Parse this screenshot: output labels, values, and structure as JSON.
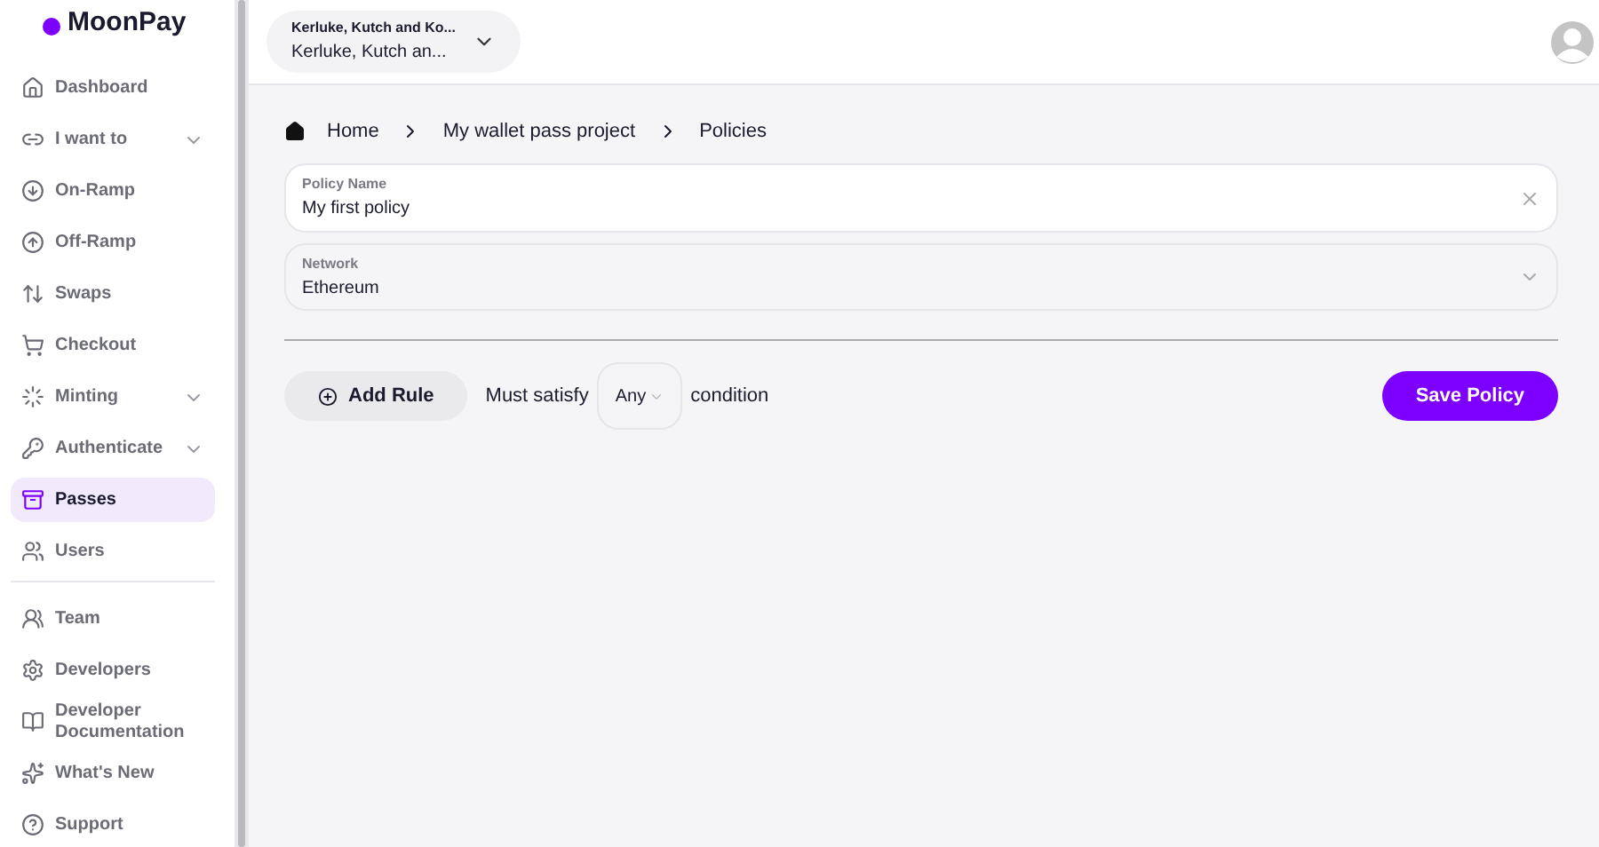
{
  "brand": {
    "name": "MoonPay"
  },
  "sidebar": {
    "groups": [
      {
        "items": [
          {
            "label": "Dashboard",
            "has_submenu": false,
            "selected": false
          },
          {
            "label": "I want to",
            "has_submenu": true,
            "selected": false
          },
          {
            "label": "On-Ramp",
            "has_submenu": false,
            "selected": false
          },
          {
            "label": "Off-Ramp",
            "has_submenu": false,
            "selected": false
          },
          {
            "label": "Swaps",
            "has_submenu": false,
            "selected": false
          },
          {
            "label": "Checkout",
            "has_submenu": false,
            "selected": false
          },
          {
            "label": "Minting",
            "has_submenu": true,
            "selected": false
          },
          {
            "label": "Authenticate",
            "has_submenu": true,
            "selected": false
          },
          {
            "label": "Passes",
            "has_submenu": false,
            "selected": true
          },
          {
            "label": "Users",
            "has_submenu": false,
            "selected": false
          }
        ]
      },
      {
        "items": [
          {
            "label": "Team",
            "has_submenu": false,
            "selected": false
          },
          {
            "label": "Developers",
            "has_submenu": false,
            "selected": false
          },
          {
            "label": "Developer Documentation",
            "has_submenu": false,
            "selected": false
          },
          {
            "label": "What's New",
            "has_submenu": false,
            "selected": false
          },
          {
            "label": "Support",
            "has_submenu": false,
            "selected": false
          }
        ]
      }
    ]
  },
  "account_switcher": {
    "title": "Kerluke, Kutch and Ko...",
    "subtitle": "Kerluke, Kutch an..."
  },
  "breadcrumb": [
    "Home",
    "My wallet pass project",
    "Policies"
  ],
  "form": {
    "policy_name": {
      "label": "Policy Name",
      "value": "My first policy"
    },
    "network": {
      "label": "Network",
      "value": "Ethereum"
    }
  },
  "rules_bar": {
    "add_rule": "Add Rule",
    "prefix": "Must satisfy",
    "match": "Any",
    "suffix": "condition",
    "save": "Save Policy"
  }
}
